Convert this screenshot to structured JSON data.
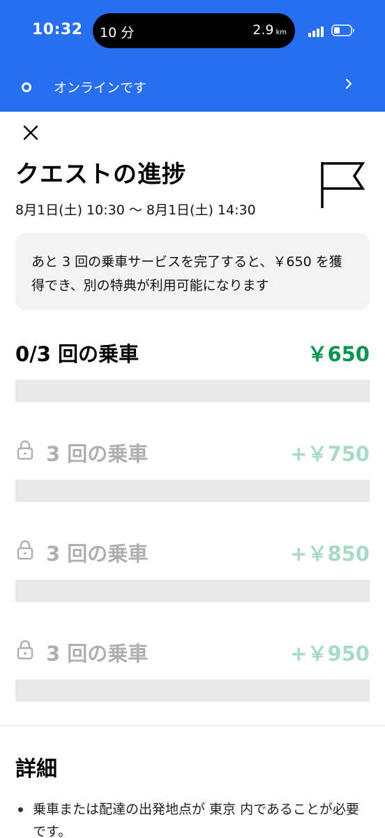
{
  "status_bar": {
    "time": "10:32",
    "island_left": "10 分",
    "island_distance": "2.9",
    "island_unit": "km"
  },
  "online_bar": {
    "label": "オンラインです",
    "color": "#276ef1"
  },
  "header": {
    "title": "クエストの進捗",
    "date_range": "8月1日(土) 10:30 〜 8月1日(土) 14:30"
  },
  "info_box": {
    "text": "あと 3 回の乗車サービスを完了すると、￥650 を獲得でき、別の特典が利用可能になります"
  },
  "tiers": [
    {
      "label": "0/3 回の乗車",
      "amount": "￥650",
      "locked": false,
      "progress": 0
    },
    {
      "label": "3 回の乗車",
      "amount": "+￥750",
      "locked": true,
      "progress": 0
    },
    {
      "label": "3 回の乗車",
      "amount": "+￥850",
      "locked": true,
      "progress": 0
    },
    {
      "label": "3 回の乗車",
      "amount": "+￥950",
      "locked": true,
      "progress": 0
    }
  ],
  "details": {
    "title": "詳細",
    "items": [
      "乗車または配達の出発地点が 東京 内であることが必要です。"
    ]
  },
  "colors": {
    "earned_amount": "#05944f",
    "locked_amount": "#a8dbc3",
    "locked_label": "#afafaf",
    "progress_track": "#e8e8e8"
  }
}
